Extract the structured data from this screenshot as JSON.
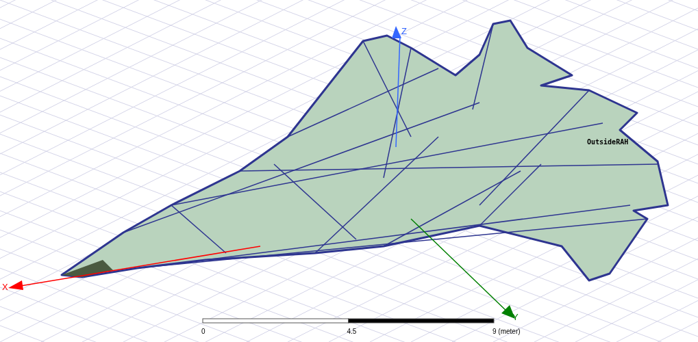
{
  "axes": [
    {
      "kind": "z",
      "label": "Z",
      "color": "#3366ff"
    },
    {
      "kind": "x",
      "label": "X",
      "color": "#ff0000"
    },
    {
      "kind": "y",
      "label": "Y",
      "color": "#008000"
    }
  ],
  "object_label": "OutsideRAH",
  "scale_bar": {
    "ticks": [
      "0",
      "4.5",
      "9 (meter)"
    ]
  }
}
